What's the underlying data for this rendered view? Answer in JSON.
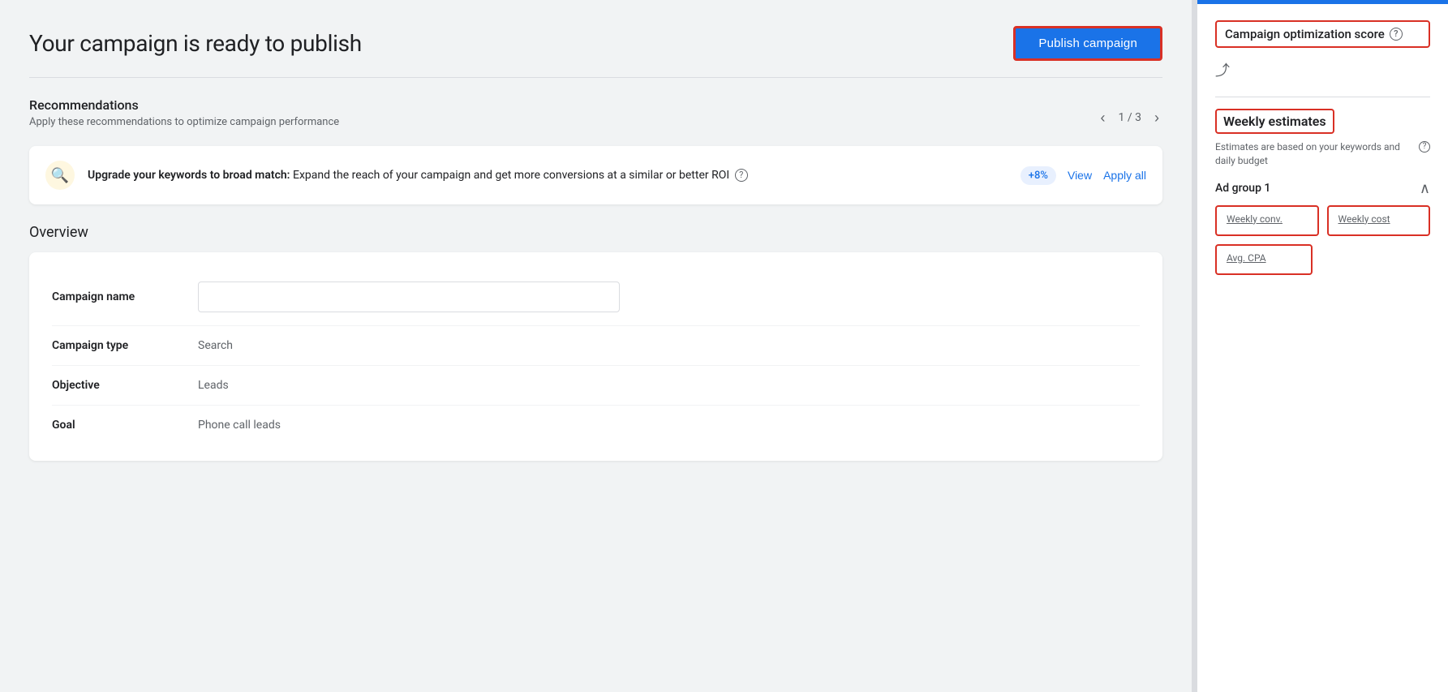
{
  "page": {
    "title": "Your campaign is ready to publish"
  },
  "header": {
    "publish_button_label": "Publish campaign"
  },
  "recommendations": {
    "section_label": "Recommendations",
    "section_sub": "Apply these recommendations to optimize campaign performance",
    "pagination": "1 / 3",
    "card": {
      "badge": "+8%",
      "title_bold": "Upgrade your keywords to broad match:",
      "title_rest": " Expand the reach of your campaign and get more conversions at a similar or better ROI",
      "view_label": "View",
      "apply_label": "Apply all"
    }
  },
  "overview": {
    "title": "Overview",
    "rows": [
      {
        "key": "Campaign name",
        "value": "",
        "type": "input",
        "placeholder": ""
      },
      {
        "key": "Campaign type",
        "value": "Search",
        "type": "text"
      },
      {
        "key": "Objective",
        "value": "Leads",
        "type": "text"
      },
      {
        "key": "Goal",
        "value": "Phone call leads",
        "type": "text"
      }
    ]
  },
  "sidebar": {
    "optimization_score": {
      "label": "Campaign optimization score",
      "info_icon": "?"
    },
    "weekly_estimates": {
      "title": "Weekly estimates",
      "subtitle": "Estimates are based on your keywords and daily budget",
      "info_icon": "?",
      "ad_group_label": "Ad group 1",
      "stats": [
        {
          "label": "Weekly conv.",
          "value": ""
        },
        {
          "label": "Weekly cost",
          "value": ""
        }
      ],
      "avg_cpa": {
        "label": "Avg. CPA",
        "value": ""
      }
    }
  },
  "icons": {
    "search": "🔍",
    "trend": "∿",
    "chevron_up": "∧",
    "chevron_left": "‹",
    "chevron_right": "›"
  }
}
